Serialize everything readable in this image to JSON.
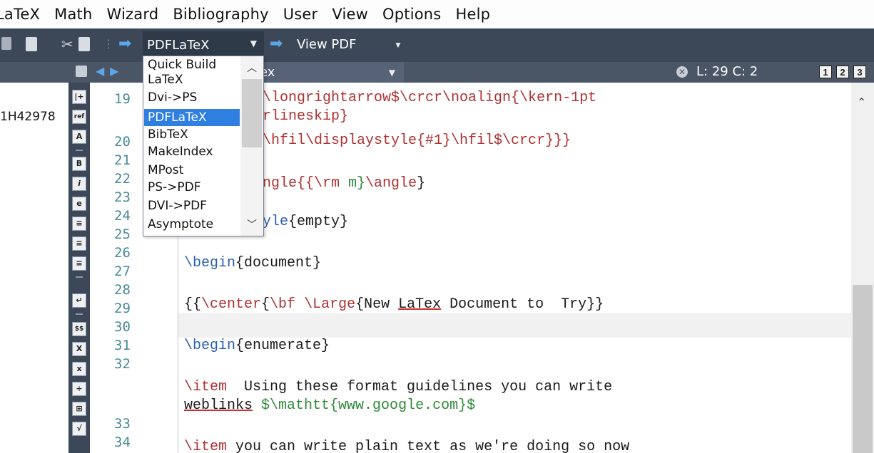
{
  "menu": [
    "LaTeX",
    "Math",
    "Wizard",
    "Bibliography",
    "User",
    "View",
    "Options",
    "Help"
  ],
  "toolbar": {
    "build_value": "PDFLaTeX",
    "view_value": "View PDF"
  },
  "tab": {
    "filename_partial": "ex",
    "position": "L: 29 C: 2",
    "view_numbers": [
      "1",
      "2",
      "3"
    ]
  },
  "left_panel": {
    "id_text": "1H42978"
  },
  "icon_strip": [
    "|+",
    "ref",
    "A",
    "B",
    "i",
    "e",
    "≡",
    "≡",
    "≡",
    "↵",
    "$$",
    "X",
    "x",
    "÷",
    "⊞",
    "√"
  ],
  "dropdown": {
    "items": [
      "Quick Build",
      "LaTeX",
      "Dvi->PS",
      "PDFLaTeX",
      "BibTeX",
      "MakeIndex",
      "MPost",
      "PS->PDF",
      "DVI->PDF",
      "Asymptote"
    ],
    "selected": "PDFLaTeX"
  },
  "line_numbers": [
    "19",
    "20",
    "21",
    "22",
    "23",
    "24",
    "25",
    "26",
    "27",
    "28",
    "29",
    "30",
    "31",
    "32",
    "33",
    "34"
  ],
  "code": {
    "l19a_cmd": "\\longrightarrow$\\crcr\\noalign{\\kern-1pt",
    "l19b": "rlineskip}",
    "l20": "\\hfil\\displaystyle{#1}\\hfil$\\crcr}}}",
    "l22_a": "ngle{{",
    "l22_b": "\\rm",
    "l22_c": " m}",
    "l22_d": "\\angle",
    "l22_e": "}",
    "l24_a": "yle",
    "l24_b": "{empty}",
    "l26_kw": "\\begin",
    "l26_arg": "{document}",
    "l28_a": "{{",
    "l28_b": "\\center",
    "l28_c": "{",
    "l28_d": "\\bf",
    "l28_e": " ",
    "l28_f": "\\Large",
    "l28_g": "{New ",
    "l28_h": "LaTex",
    "l28_i": " Document to  Try}}",
    "l30_kw": "\\begin",
    "l30_arg": "{enumerate}",
    "l32_kw": "\\item",
    "l32_text": "  Using these format guidelines you can write",
    "l32b_und": "weblinks",
    "l32b_sp": " ",
    "l32b_math": "$\\mathtt{www.google.com}$",
    "l34_kw": "\\item",
    "l34_text": " you can write plain text as we're doing so now"
  }
}
